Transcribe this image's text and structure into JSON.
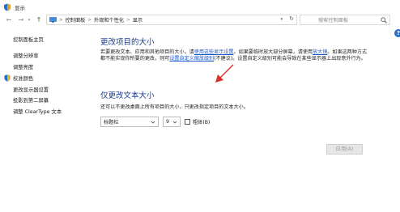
{
  "window": {
    "title": "显示"
  },
  "address_bar": {
    "crumbs": [
      "控制面板",
      "外观和个性化",
      "显示"
    ],
    "separator": ">"
  },
  "search": {
    "placeholder": "搜索控制面板"
  },
  "sidebar": {
    "home": "控制面板主页",
    "items": [
      "调整分辨率",
      "调整亮度",
      "校准颜色",
      "更改显示器设置",
      "投影到第二屏幕",
      "调整 ClearType 文本"
    ]
  },
  "main": {
    "heading1": "更改项目的大小",
    "para_parts": {
      "p1": "若要更改文本、应用和其他项目的大小，请",
      "link1": "使用这些显示设置",
      "p2": "。如果要临时放大部分屏幕，请使用",
      "link2": "放大镜",
      "p3": "。如果这两种方式都不能实现你所要的更改，则可",
      "link3": "设置自定义缩放级别",
      "p4": "(不建议)。设置自定义级别可能会导致在某些显示器上出现意外行为。"
    },
    "heading2": "仅更改文本大小",
    "para2": "还可以不更改桌面上所有项目的大小，只更改指定项目的文本大小。",
    "item_select": "标题栏",
    "size_select": "9",
    "bold_label": "粗体(B)",
    "bold_checked": false,
    "apply_label": "应用(A)"
  },
  "colors": {
    "heading": "#1c3d8c",
    "link": "#1a56c9",
    "annotation_arrow": "#d9312b"
  }
}
